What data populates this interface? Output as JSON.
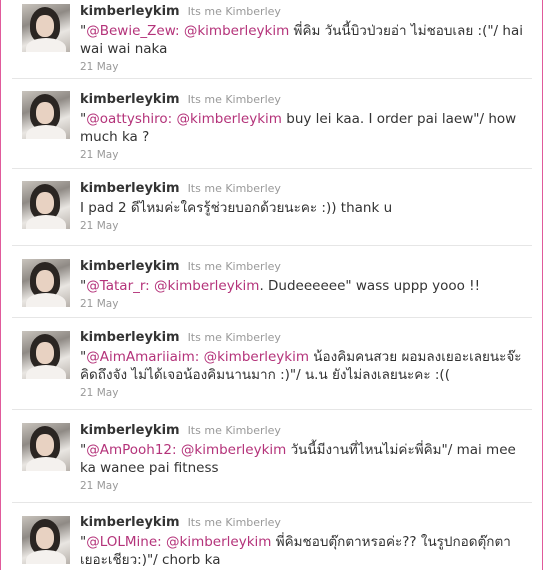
{
  "tweets": [
    {
      "screen_name": "kimberleykim",
      "full_name": "Its me Kimberley",
      "q1": "\"",
      "m1": "@Bewie_Zew:",
      "sp": " ",
      "m2": "@kimberleykim",
      "rest": " พี่คิม วันนี้บิวป่วยอ่า ไม่ชอบเลย :(\"/ hai wai wai naka",
      "date": "21 May"
    },
    {
      "screen_name": "kimberleykim",
      "full_name": "Its me Kimberley",
      "q1": "\"",
      "m1": "@oattyshiro:",
      "sp": " ",
      "m2": "@kimberleykim",
      "rest": " buy lei kaa. I order pai laew\"/ how much ka ?",
      "date": "21 May"
    },
    {
      "screen_name": "kimberleykim",
      "full_name": "Its me Kimberley",
      "text": "I pad 2 ดีไหมค่ะใครรู้ช่วยบอกด้วยนะคะ :)) thank u",
      "date": "21 May"
    },
    {
      "screen_name": "kimberleykim",
      "full_name": "Its me Kimberley",
      "q1": "\"",
      "m1": "@Tatar_r:",
      "sp": " ",
      "m2": "@kimberleykim",
      "rest": ". Dudeeeeee\" wass uppp yooo !!",
      "date": "21 May"
    },
    {
      "screen_name": "kimberleykim",
      "full_name": "Its me Kimberley",
      "q1": "\"",
      "m1": "@AimAmariiaim:",
      "sp": " ",
      "m2": "@kimberleykim",
      "rest": " น้องคิมคนสวย ผอมลงเยอะเลยนะจ๊ะ คิดถึงจัง ไม่ได้เจอน้องคิมนานมาก :)\"/ น.น ยังไม่ลงเลยนะคะ :((",
      "date": "21 May"
    },
    {
      "screen_name": "kimberleykim",
      "full_name": "Its me Kimberley",
      "q1": "\"",
      "m1": "@AmPooh12:",
      "sp": " ",
      "m2": "@kimberleykim",
      "rest": " วันนี้มีงานที่ไหนไม่ค่ะพี่คิม\"/ mai mee ka wanee pai fitness",
      "date": "21 May"
    },
    {
      "screen_name": "kimberleykim",
      "full_name": "Its me Kimberley",
      "q1": "\"",
      "m1": "@LOLMine:",
      "sp": " ",
      "m2": "@kimberleykim",
      "rest": " พี่คิมชอบตุ๊กตาหรอค่ะ?? ในรูปกอดตุ๊กตาเยอะเชียว:)\"/ chorb ka",
      "date": ""
    }
  ],
  "colors": {
    "mention": "#b4337a",
    "screen_name": "#333333",
    "meta": "#999999",
    "frame_border": "#e05a9b"
  }
}
